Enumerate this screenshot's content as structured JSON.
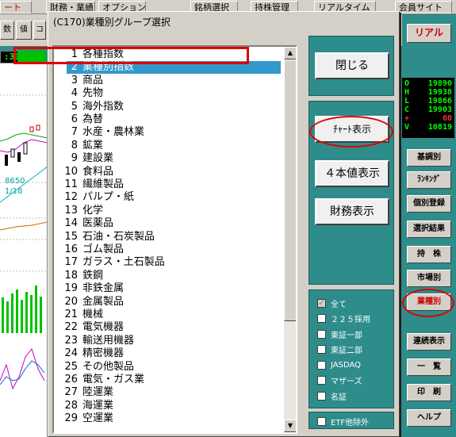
{
  "background_app": {
    "top_tabs": [
      "ート",
      "財務・業績",
      "オプション",
      "銘柄選択",
      "持株管理",
      "リアルタイム",
      "会員サイト"
    ],
    "sub_buttons": [
      "数",
      "値",
      "コ"
    ],
    "time": ":30",
    "chart_labels": [
      "8650",
      "1/18"
    ],
    "ohlc": [
      {
        "label": "O",
        "value": "19890",
        "color": "#00ff00"
      },
      {
        "label": "H",
        "value": "19938",
        "color": "#00ff00"
      },
      {
        "label": "L",
        "value": "19866",
        "color": "#00ff00"
      },
      {
        "label": "C",
        "value": "19903",
        "color": "#00ff00"
      },
      {
        "label": "+",
        "value": "60",
        "color": "#ff3030"
      },
      {
        "label": "V",
        "value": "10819",
        "color": "#00ff00"
      }
    ],
    "side_buttons": {
      "riaru": "リアル",
      "kichou": "基調別",
      "ranking": "ﾗﾝｷﾝｸﾞ",
      "kobetsu": "個別登録",
      "sentaku": "選択結果",
      "mochikabu": "持　株",
      "shijou": "市場別",
      "gyoushu": "業種別",
      "renzoku": "連続表示",
      "ichiran": "一　覧",
      "insatsu": "印　刷",
      "help": "ヘルプ"
    }
  },
  "dialog": {
    "title": "(C170)業種別グループ選択",
    "list": [
      {
        "num": "1",
        "label": "各種指数"
      },
      {
        "num": "2",
        "label": "業種別指数"
      },
      {
        "num": "3",
        "label": "商品"
      },
      {
        "num": "4",
        "label": "先物"
      },
      {
        "num": "5",
        "label": "海外指数"
      },
      {
        "num": "6",
        "label": "為替"
      },
      {
        "num": "7",
        "label": "水産・農林業"
      },
      {
        "num": "8",
        "label": "鉱業"
      },
      {
        "num": "9",
        "label": "建設業"
      },
      {
        "num": "10",
        "label": "食料品"
      },
      {
        "num": "11",
        "label": "繊維製品"
      },
      {
        "num": "12",
        "label": "パルプ・紙"
      },
      {
        "num": "13",
        "label": "化学"
      },
      {
        "num": "14",
        "label": "医薬品"
      },
      {
        "num": "15",
        "label": "石油・石炭製品"
      },
      {
        "num": "16",
        "label": "ゴム製品"
      },
      {
        "num": "17",
        "label": "ガラス・土石製品"
      },
      {
        "num": "18",
        "label": "鉄鋼"
      },
      {
        "num": "19",
        "label": "非鉄金属"
      },
      {
        "num": "20",
        "label": "金属製品"
      },
      {
        "num": "21",
        "label": "機械"
      },
      {
        "num": "22",
        "label": "電気機器"
      },
      {
        "num": "23",
        "label": "輸送用機器"
      },
      {
        "num": "24",
        "label": "精密機器"
      },
      {
        "num": "25",
        "label": "その他製品"
      },
      {
        "num": "26",
        "label": "電気・ガス業"
      },
      {
        "num": "27",
        "label": "陸運業"
      },
      {
        "num": "28",
        "label": "海運業"
      },
      {
        "num": "29",
        "label": "空運業"
      }
    ],
    "selected_index": 1,
    "buttons": {
      "close": "閉じる",
      "chart": "ﾁｬｰﾄ表示",
      "four_price": "４本値表示",
      "financial": "財務表示"
    },
    "filters": [
      {
        "label": "全て",
        "checked": true,
        "disabled": true
      },
      {
        "label": "２２５採用",
        "checked": false,
        "disabled": false
      },
      {
        "label": "東証一部",
        "checked": false,
        "disabled": false
      },
      {
        "label": "東証二部",
        "checked": false,
        "disabled": false
      },
      {
        "label": "JASDAQ",
        "checked": false,
        "disabled": false
      },
      {
        "label": "マザーズ",
        "checked": false,
        "disabled": false
      },
      {
        "label": "名証",
        "checked": false,
        "disabled": false
      }
    ],
    "etf_filter": {
      "label": "ETF他除外",
      "checked": false
    }
  },
  "colors": {
    "panel_teal": "#2e8c8a",
    "selection": "#3399cc",
    "highlight_red": "#e00000"
  }
}
